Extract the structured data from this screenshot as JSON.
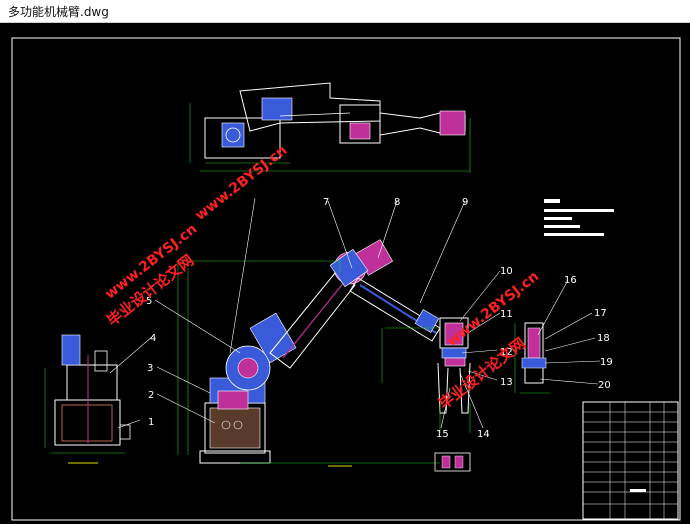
{
  "window": {
    "title": "多功能机械臂.dwg"
  },
  "watermarks": [
    {
      "line1": "www.2BYSJ.cn",
      "line2": "毕业设计论文网"
    },
    {
      "line1": "www.2BYSJ.cn",
      "line2": "毕业设计论文网"
    },
    {
      "line1": "www.2BYSJ.cn",
      "line2": "毕业设计论文网"
    }
  ],
  "balloons": [
    "1",
    "2",
    "3",
    "4",
    "5",
    "7",
    "8",
    "9",
    "10",
    "11",
    "12",
    "13",
    "14",
    "15",
    "16",
    "17",
    "18",
    "19",
    "20"
  ],
  "colors": {
    "background": "#000000",
    "outline": "#ffffff",
    "part_blue": "#3a5bd9",
    "part_magenta": "#c0309a",
    "dimension": "#22c422",
    "leader_yellow": "#e0e000",
    "watermark": "#ff2020"
  }
}
